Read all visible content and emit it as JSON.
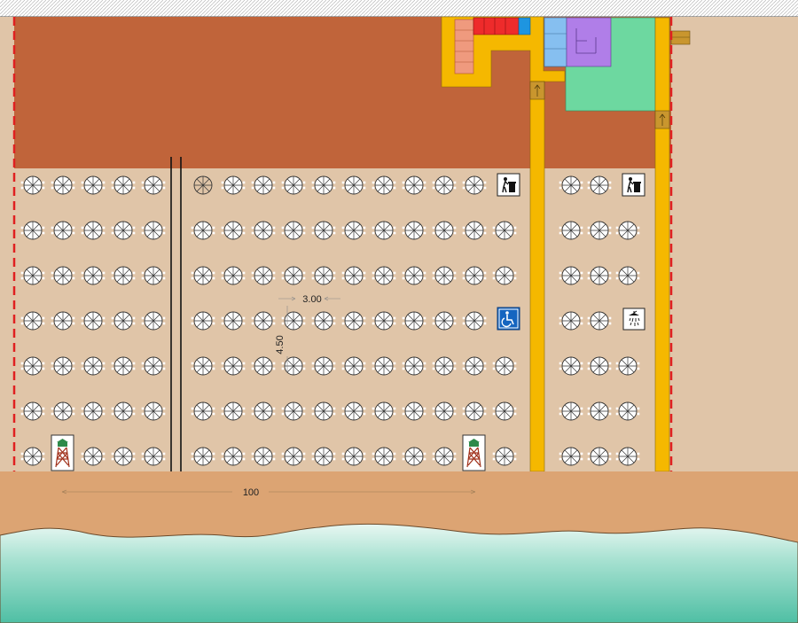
{
  "colors": {
    "sand": "#e0c5a8",
    "soil": "#c0643a",
    "wet_sand": "#dca473",
    "sea_light": "#e6f6f1",
    "sea_dark": "#4fbfa4",
    "walkway": "#f5b800",
    "boundary": "#e02020",
    "green_area": "#6dd8a0",
    "purple_area": "#b07ee8",
    "blue_area": "#86bff0",
    "red_area": "#ee2b2b",
    "cyan_area": "#1e95e0",
    "salmon_area": "#ef9a7e"
  },
  "icons": {
    "umbrella": "umbrella-icon",
    "trash": "trash-bin-icon",
    "accessible": "wheelchair-icon",
    "shower": "shower-icon",
    "lifeguard": "lifeguard-tower-icon",
    "recycle": "recycle-icon"
  },
  "dimensions": {
    "spacing_x": "3.00",
    "spacing_y": "4.50",
    "total_width": "100"
  }
}
